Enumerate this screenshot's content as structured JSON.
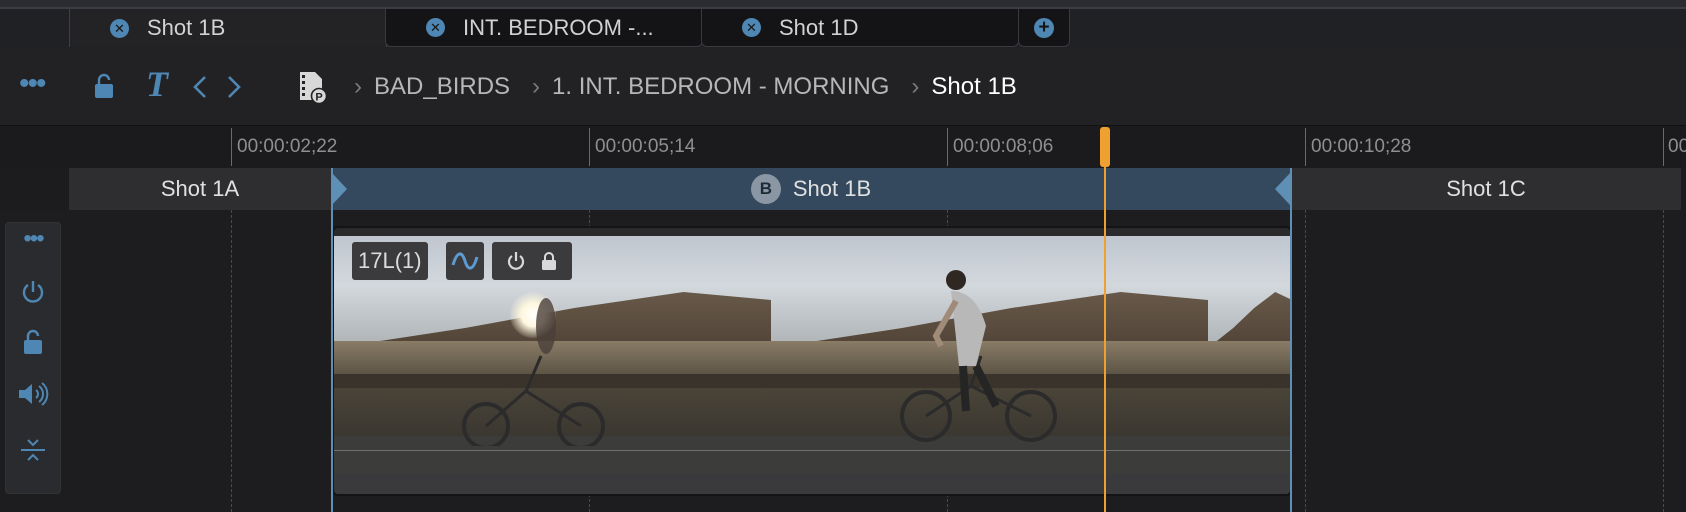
{
  "tabs": [
    {
      "label": "Shot 1B",
      "active": true
    },
    {
      "label": "INT. BEDROOM -...",
      "active": false
    },
    {
      "label": "Shot 1D",
      "active": false
    }
  ],
  "toolbar": {
    "icons": [
      "more-icon",
      "lock-open-icon",
      "text-tool-icon",
      "chevron-left-icon",
      "chevron-right-icon",
      "project-file-icon"
    ]
  },
  "breadcrumb": {
    "items": [
      "BAD_BIRDS",
      "1. INT. BEDROOM - MORNING",
      "Shot 1B"
    ]
  },
  "ruler": {
    "timecodes": [
      "00:00:02;22",
      "00:00:05;14",
      "00:00:08;06",
      "00:00:10;28",
      "00"
    ]
  },
  "shots": [
    {
      "label": "Shot 1A"
    },
    {
      "label": "Shot 1B",
      "badge": "B"
    },
    {
      "label": "Shot 1C"
    }
  ],
  "clip": {
    "tag": "17L(1)"
  },
  "colors": {
    "accent": "#4f87b4",
    "playhead": "#f0a030",
    "selected_shot_bg": "#34495e"
  }
}
